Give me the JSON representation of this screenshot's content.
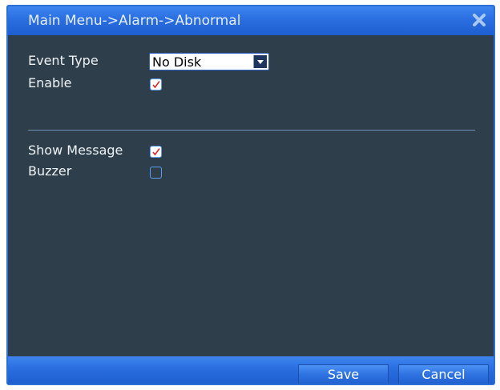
{
  "window": {
    "title": "Main Menu->Alarm->Abnormal"
  },
  "form": {
    "event_type_label": "Event Type",
    "event_type_value": "No Disk",
    "enable_label": "Enable",
    "enable_checked": true,
    "show_message_label": "Show Message",
    "show_message_checked": true,
    "buzzer_label": "Buzzer",
    "buzzer_checked": false
  },
  "footer": {
    "save_label": "Save",
    "cancel_label": "Cancel"
  },
  "colors": {
    "title_bar": "#2a6ee0",
    "panel_background": "#2e3f4b",
    "check_mark": "#e02020"
  }
}
